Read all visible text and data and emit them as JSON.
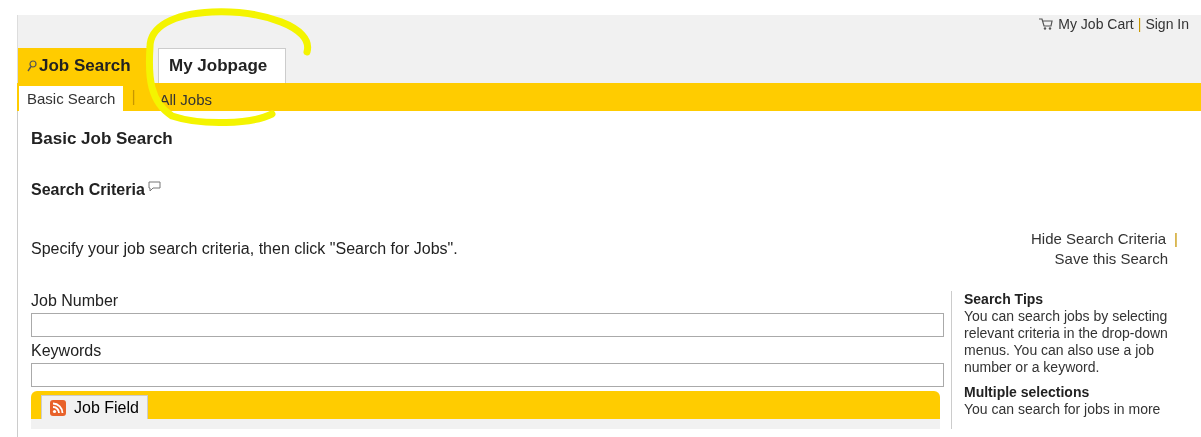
{
  "header_links": [
    {
      "label": "My Job Cart",
      "kind": "cart"
    },
    {
      "label": "Sign In",
      "kind": "plain"
    }
  ],
  "header_separator": "|",
  "subtab_separator": "|",
  "action_separator": "|",
  "tabs": [
    {
      "label": "Job Search",
      "selected": true
    },
    {
      "label": "My Jobpage",
      "selected": false
    }
  ],
  "subtabs": [
    {
      "label": "Basic Search",
      "selected": true
    },
    {
      "label": "All Jobs",
      "selected": false
    }
  ],
  "page_title": "Basic Job Search",
  "section_title": "Search Criteria",
  "instructions": "Specify your job search criteria, then click \"Search for Jobs\".",
  "actions": [
    "Hide Search Criteria",
    "Save this Search"
  ],
  "fields": [
    {
      "label": "Job Number"
    },
    {
      "label": "Keywords"
    }
  ],
  "panel_tab": {
    "label": "Job Field"
  },
  "tips": [
    {
      "title": "Search Tips",
      "text": "You can search jobs by selecting relevant criteria in the drop-down menus. You can also use a job number or a keyword."
    },
    {
      "title": "Multiple selections",
      "text": "You can search for jobs in more"
    }
  ]
}
